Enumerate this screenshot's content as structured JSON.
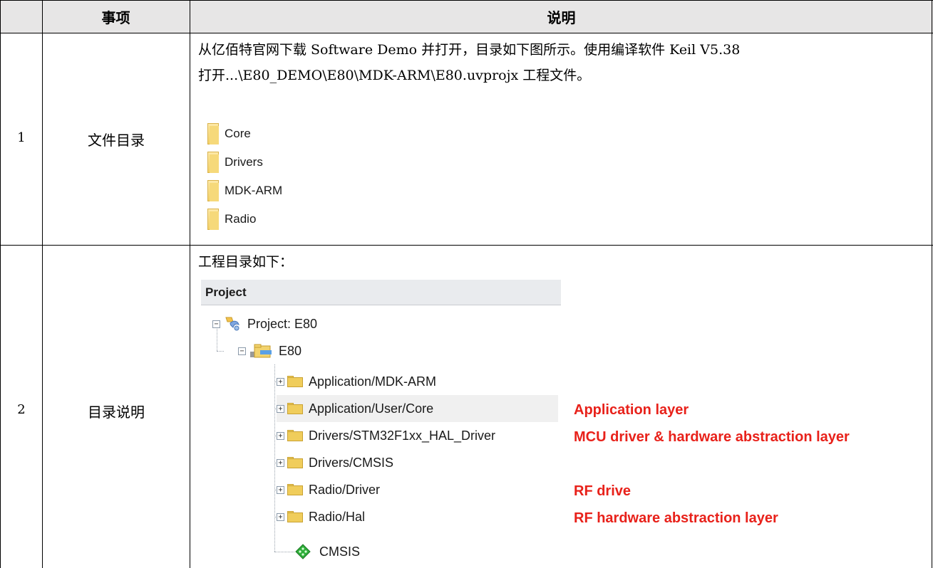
{
  "table": {
    "header": {
      "item": "事项",
      "description": "说明"
    },
    "rows": [
      {
        "number": "1",
        "item": "文件目录",
        "description_lines": [
          "从亿佰特官网下载 Software Demo 并打开，目录如下图所示。使用编译软件 Keil V5.38",
          "打开...\\E80_DEMO\\E80\\MDK-ARM\\E80.uvprojx 工程文件。"
        ],
        "folders": [
          "Core",
          "Drivers",
          "MDK-ARM",
          "Radio"
        ]
      },
      {
        "number": "2",
        "item": "目录说明",
        "description": "工程目录如下：",
        "project_panel": {
          "title": "Project",
          "root": "Project: E80",
          "target": "E80",
          "groups": [
            "Application/MDK-ARM",
            "Application/User/Core",
            "Drivers/STM32F1xx_HAL_Driver",
            "Drivers/CMSIS",
            "Radio/Driver",
            "Radio/Hal",
            "CMSIS"
          ]
        },
        "annotations": [
          "Application layer",
          "MCU driver & hardware abstraction layer",
          "RF drive",
          "RF hardware abstraction layer"
        ]
      }
    ]
  },
  "colors": {
    "header_bg": "#e7e6e6",
    "annotation": "#e8211a",
    "folder": "#f0cd5b"
  }
}
